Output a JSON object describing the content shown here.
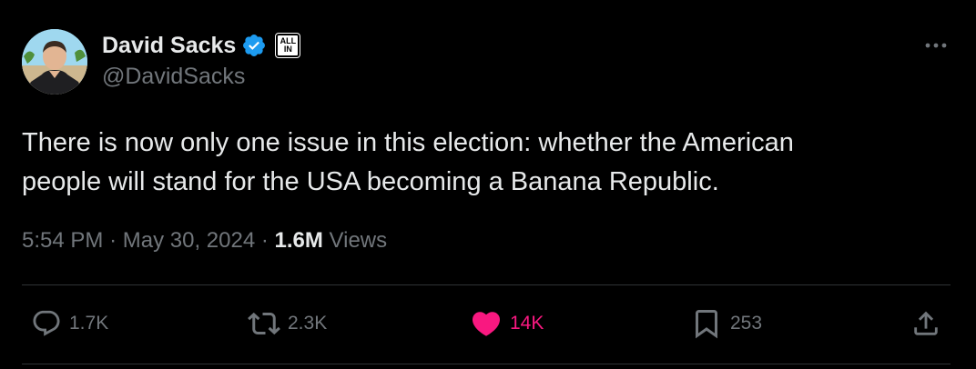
{
  "author": {
    "display_name": "David Sacks",
    "handle": "@DavidSacks",
    "verified_color": "#1d9bf0",
    "affiliate_badge_text": "ALL IN",
    "affiliate_badge_line1": "ALL",
    "affiliate_badge_line2": "IN"
  },
  "tweet": {
    "text_line1": "There is now only one issue in this election: whether the American",
    "text_line2": "people will stand for the USA becoming a Banana Republic.",
    "time": "5:54 PM",
    "separator": "·",
    "date": "May 30, 2024",
    "views_count": "1.6M",
    "views_label": "Views"
  },
  "actions": {
    "reply": {
      "icon": "reply-icon",
      "count": "1.7K"
    },
    "retweet": {
      "icon": "retweet-icon",
      "count": "2.3K"
    },
    "like": {
      "icon": "heart-icon",
      "count": "14K",
      "liked": true,
      "color": "#f91880"
    },
    "bookmark": {
      "icon": "bookmark-icon",
      "count": "253"
    },
    "share": {
      "icon": "share-icon"
    }
  },
  "colors": {
    "background": "#000000",
    "text_primary": "#e7e9ea",
    "text_secondary": "#71767b",
    "divider": "#2f3336"
  }
}
